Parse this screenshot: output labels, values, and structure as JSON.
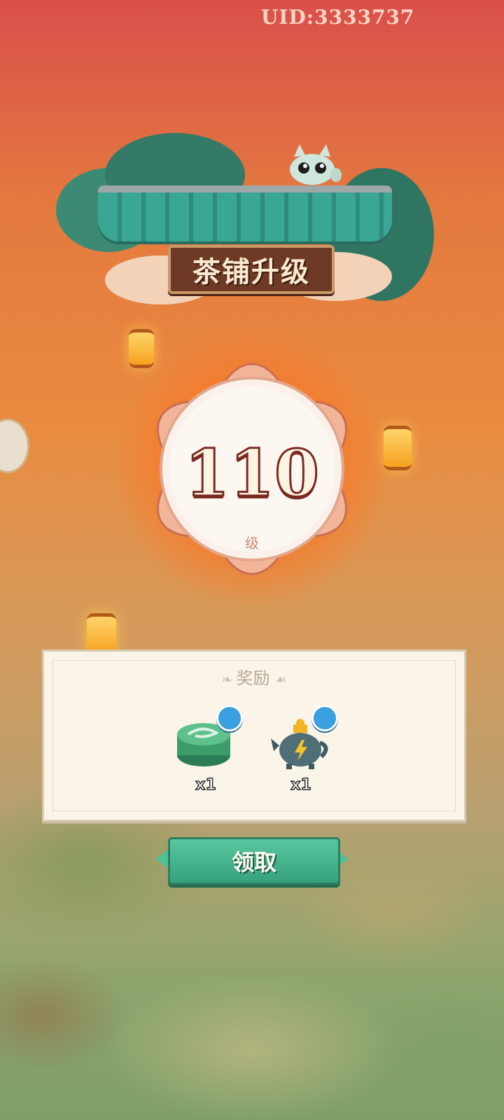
{
  "uid": "UID:3333737",
  "title": {
    "label": "茶铺升级"
  },
  "level": {
    "value": "110",
    "unit": "级"
  },
  "reward_panel": {
    "title": "奖励",
    "items": [
      {
        "icon": "jade-tea-tin-icon",
        "qty": "x1"
      },
      {
        "icon": "lightning-teapot-icon",
        "qty": "x1"
      }
    ]
  },
  "claim_button": {
    "label": "领取"
  },
  "colors": {
    "accent_green": "#36a27d",
    "title_brown": "#6e3a26",
    "level_outline": "#7a2a20"
  }
}
